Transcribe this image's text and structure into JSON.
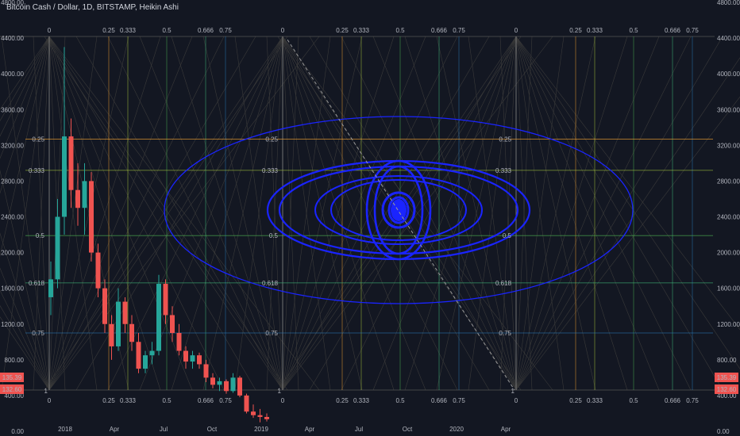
{
  "header": {
    "title": "Bitcoin Cash / Dollar, 1D, BITSTAMP, Heikin Ashi"
  },
  "colors": {
    "background": "#131722",
    "grid_line": "#2a2e39",
    "ellipse": "#1a24ff",
    "fib_025": "#f0a030",
    "fib_0333": "#a8c83c",
    "fib_05": "#4caf50",
    "fib_0618": "#3fbf7f",
    "fib_075": "#2a7ab8",
    "candle_up": "#26a69a",
    "candle_down": "#ef5350",
    "price_badge_up": "#ef5350",
    "price_badge_down": "#ef5350"
  },
  "chart_data": {
    "type": "candlestick",
    "style": "Heikin Ashi",
    "ylim": [
      0,
      4800
    ],
    "y_ticks": [
      "4800.00",
      "4400.00",
      "4000.00",
      "3600.00",
      "3200.00",
      "2800.00",
      "2400.00",
      "2000.00",
      "1600.00",
      "1200.00",
      "800.00",
      "400.00",
      "0.00"
    ],
    "x_ticks": [
      "2018",
      "Apr",
      "Jul",
      "Oct",
      "2019",
      "Apr",
      "Jul",
      "Oct",
      "2020",
      "Apr"
    ],
    "last_price_labels": [
      "135.39",
      "132.60"
    ],
    "fib_top_labels": [
      "0",
      "0.25",
      "0.333",
      "0.5",
      "0.666",
      "0.75"
    ],
    "fib_bottom_labels": [
      "0",
      "0.25",
      "0.333",
      "0.5",
      "0.666",
      "0.75"
    ],
    "fib_horizontal_levels": [
      {
        "label": "0.25",
        "price": 3270
      },
      {
        "label": "0.333",
        "price": 2920
      },
      {
        "label": "0.5",
        "price": 2190
      },
      {
        "label": "0.618",
        "price": 1660
      },
      {
        "label": "0.75",
        "price": 1100
      }
    ],
    "fib_grid_corner_labels": [
      "0",
      "1"
    ],
    "price_series": [
      {
        "t": 0,
        "o": 1500,
        "h": 1900,
        "l": 1300,
        "c": 1700
      },
      {
        "t": 1,
        "o": 1700,
        "h": 2600,
        "l": 1600,
        "c": 2400
      },
      {
        "t": 2,
        "o": 2400,
        "h": 4300,
        "l": 2200,
        "c": 3300
      },
      {
        "t": 3,
        "o": 3300,
        "h": 3500,
        "l": 2500,
        "c": 2700
      },
      {
        "t": 4,
        "o": 2700,
        "h": 3000,
        "l": 2300,
        "c": 2500
      },
      {
        "t": 5,
        "o": 2500,
        "h": 3000,
        "l": 2200,
        "c": 2800
      },
      {
        "t": 6,
        "o": 2800,
        "h": 2900,
        "l": 1900,
        "c": 2000
      },
      {
        "t": 7,
        "o": 2000,
        "h": 2100,
        "l": 1500,
        "c": 1600
      },
      {
        "t": 8,
        "o": 1600,
        "h": 1700,
        "l": 1100,
        "c": 1200
      },
      {
        "t": 9,
        "o": 1200,
        "h": 1300,
        "l": 800,
        "c": 950
      },
      {
        "t": 10,
        "o": 950,
        "h": 1600,
        "l": 900,
        "c": 1450
      },
      {
        "t": 11,
        "o": 1450,
        "h": 1500,
        "l": 1100,
        "c": 1200
      },
      {
        "t": 12,
        "o": 1200,
        "h": 1300,
        "l": 900,
        "c": 1000
      },
      {
        "t": 13,
        "o": 1000,
        "h": 1100,
        "l": 650,
        "c": 700
      },
      {
        "t": 14,
        "o": 700,
        "h": 900,
        "l": 650,
        "c": 850
      },
      {
        "t": 15,
        "o": 850,
        "h": 1000,
        "l": 750,
        "c": 900
      },
      {
        "t": 16,
        "o": 900,
        "h": 1750,
        "l": 850,
        "c": 1650
      },
      {
        "t": 17,
        "o": 1650,
        "h": 1700,
        "l": 1200,
        "c": 1300
      },
      {
        "t": 18,
        "o": 1300,
        "h": 1400,
        "l": 1000,
        "c": 1100
      },
      {
        "t": 19,
        "o": 1100,
        "h": 1200,
        "l": 850,
        "c": 900
      },
      {
        "t": 20,
        "o": 900,
        "h": 950,
        "l": 700,
        "c": 780
      },
      {
        "t": 21,
        "o": 780,
        "h": 900,
        "l": 700,
        "c": 850
      },
      {
        "t": 22,
        "o": 850,
        "h": 880,
        "l": 700,
        "c": 750
      },
      {
        "t": 23,
        "o": 750,
        "h": 800,
        "l": 550,
        "c": 600
      },
      {
        "t": 24,
        "o": 600,
        "h": 650,
        "l": 480,
        "c": 520
      },
      {
        "t": 25,
        "o": 520,
        "h": 600,
        "l": 450,
        "c": 560
      },
      {
        "t": 26,
        "o": 560,
        "h": 580,
        "l": 420,
        "c": 450
      },
      {
        "t": 27,
        "o": 450,
        "h": 650,
        "l": 430,
        "c": 600
      },
      {
        "t": 28,
        "o": 600,
        "h": 620,
        "l": 380,
        "c": 400
      },
      {
        "t": 29,
        "o": 400,
        "h": 420,
        "l": 200,
        "c": 220
      },
      {
        "t": 30,
        "o": 220,
        "h": 300,
        "l": 150,
        "c": 180
      },
      {
        "t": 31,
        "o": 180,
        "h": 250,
        "l": 100,
        "c": 160
      },
      {
        "t": 32,
        "o": 160,
        "h": 200,
        "l": 110,
        "c": 135
      }
    ]
  }
}
